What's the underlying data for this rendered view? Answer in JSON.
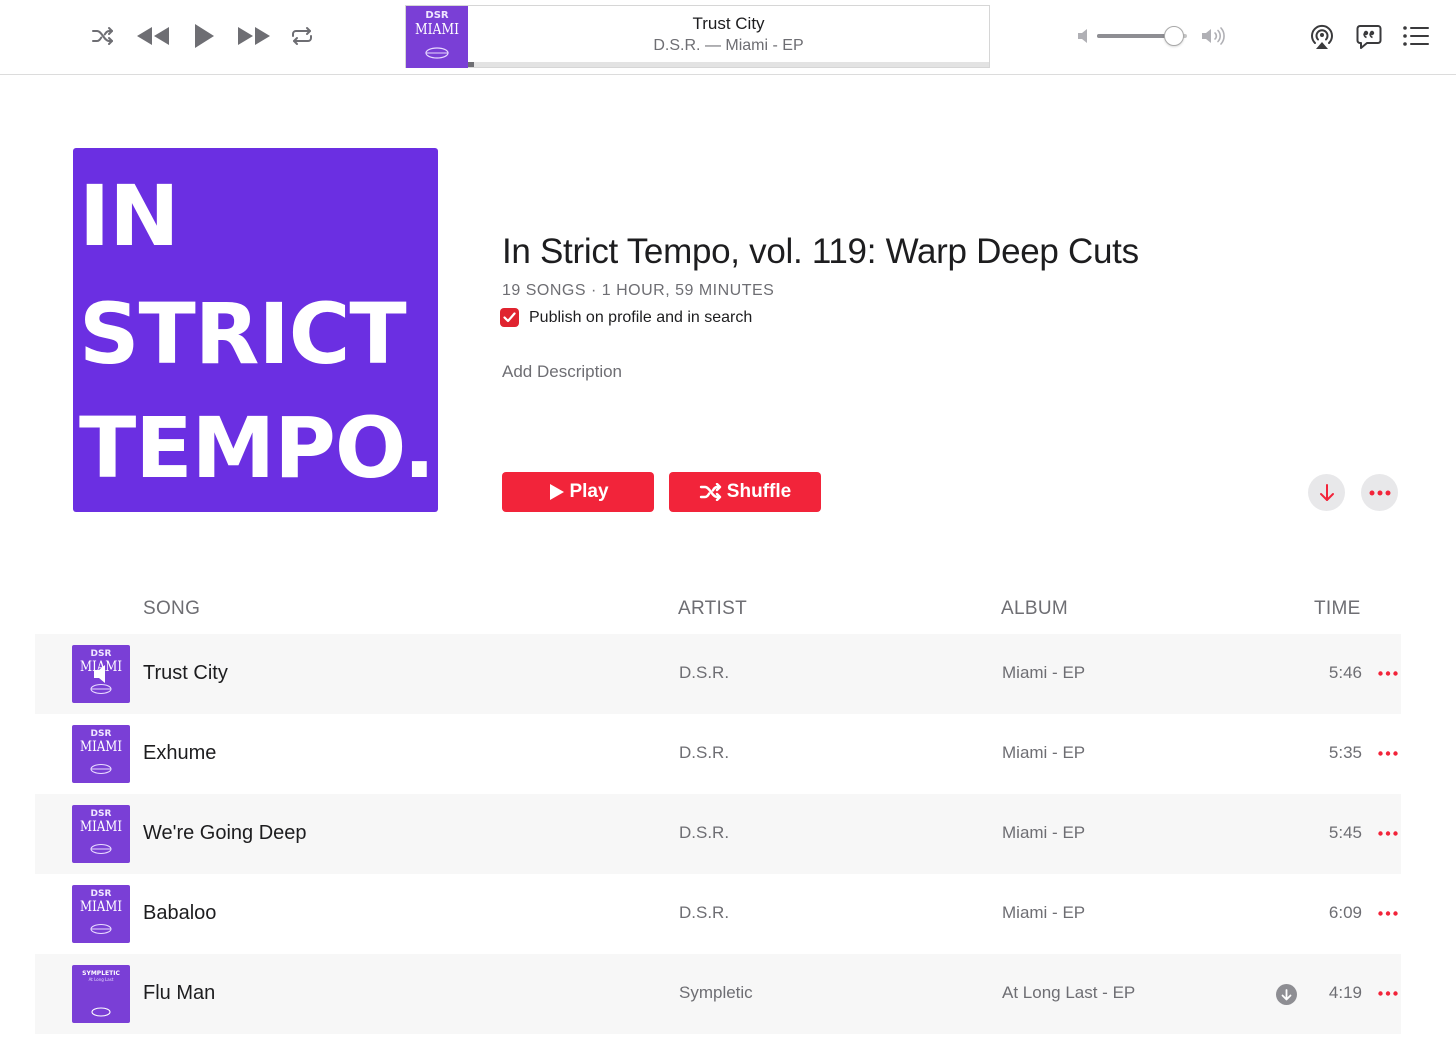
{
  "colors": {
    "accent_red": "#f2243a",
    "cover_purple": "#6b2fe2",
    "art_purple": "#7a3fd6",
    "secondary_text": "#6e6e73"
  },
  "toolbar": {
    "controls": [
      "shuffle-icon",
      "previous-icon",
      "play-icon",
      "next-icon",
      "repeat-icon"
    ],
    "now_playing": {
      "art_lines": [
        "DSR",
        "MIAMI"
      ],
      "title": "Trust City",
      "subtitle": "D.S.R. — Miami - EP",
      "progress": 0.012
    },
    "volume": 0.85,
    "right_icons": [
      "airplay-icon",
      "lyrics-icon",
      "queue-list-icon"
    ]
  },
  "playlist": {
    "cover_lines": [
      "IN",
      "STRICT",
      "TEMPO."
    ],
    "title": "In Strict Tempo, vol. 119: Warp Deep Cuts",
    "meta": "19 SONGS · 1 HOUR, 59 MINUTES",
    "publish_label": "Publish on profile and in search",
    "publish_checked": true,
    "add_description": "Add Description",
    "play_label": "Play",
    "shuffle_label": "Shuffle"
  },
  "table": {
    "headers": {
      "song": "SONG",
      "artist": "ARTIST",
      "album": "ALBUM",
      "time": "TIME"
    },
    "rows": [
      {
        "title": "Trust City",
        "artist": "D.S.R.",
        "album": "Miami - EP",
        "time": "5:46",
        "art": "dsr",
        "art_lines": [
          "DSR",
          "MIAMI"
        ],
        "playing": true,
        "download": false
      },
      {
        "title": "Exhume",
        "artist": "D.S.R.",
        "album": "Miami - EP",
        "time": "5:35",
        "art": "dsr",
        "art_lines": [
          "DSR",
          "MIAMI"
        ],
        "playing": false,
        "download": false
      },
      {
        "title": "We're Going Deep",
        "artist": "D.S.R.",
        "album": "Miami - EP",
        "time": "5:45",
        "art": "dsr",
        "art_lines": [
          "DSR",
          "MIAMI"
        ],
        "playing": false,
        "download": false
      },
      {
        "title": "Babaloo",
        "artist": "D.S.R.",
        "album": "Miami - EP",
        "time": "6:09",
        "art": "dsr",
        "art_lines": [
          "DSR",
          "MIAMI"
        ],
        "playing": false,
        "download": false
      },
      {
        "title": "Flu Man",
        "artist": "Sympletic",
        "album": "At Long Last - EP",
        "time": "4:19",
        "art": "sympletic",
        "art_lines": [
          "SYMPLETIC",
          "At Long Last"
        ],
        "playing": false,
        "download": true
      }
    ]
  }
}
